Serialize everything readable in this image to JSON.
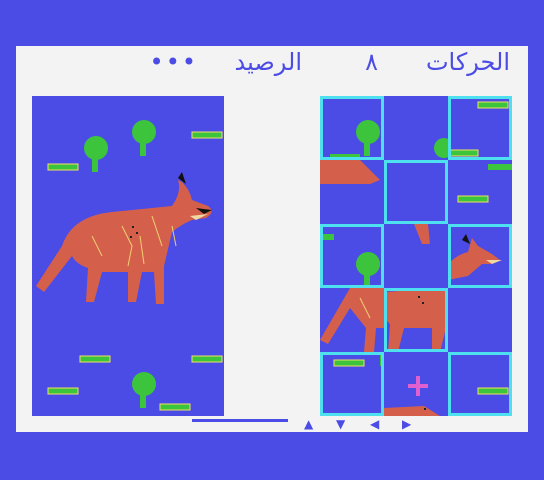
{
  "status": {
    "moves_label": "الحركات",
    "moves_value": "٨",
    "score_label": "الرصيد",
    "score_value": "•••"
  },
  "controls": {
    "up": "▲",
    "down": "▼",
    "left": "◀",
    "right": "▶"
  },
  "colors": {
    "background": "#4b4be6",
    "panel": "#f3f3f3",
    "tile_border": "#4fe0f0",
    "fox": "#d4604c",
    "cursor": "#e060d0"
  },
  "puzzle": {
    "grid": "3x5",
    "empty_tile": "row2-col2",
    "cursor": "row5-col2"
  }
}
